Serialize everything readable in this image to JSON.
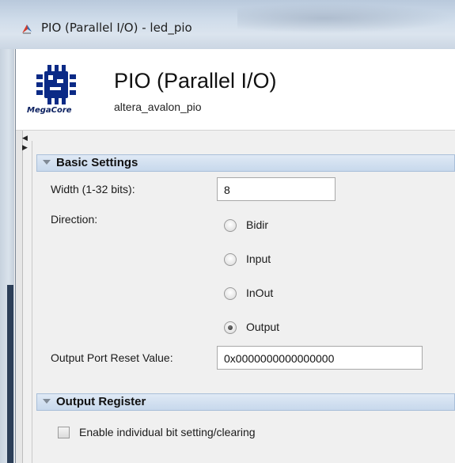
{
  "window": {
    "title": "PIO (Parallel I/O) - led_pio"
  },
  "header": {
    "logo_text": "MegaCore",
    "title": "PIO (Parallel I/O)",
    "subtitle": "altera_avalon_pio"
  },
  "basic_settings": {
    "section_label": "Basic Settings",
    "width_label": "Width (1-32 bits):",
    "width_value": "8",
    "direction_label": "Direction:",
    "direction_options": [
      {
        "label": "Bidir",
        "checked": false
      },
      {
        "label": "Input",
        "checked": false
      },
      {
        "label": "InOut",
        "checked": false
      },
      {
        "label": "Output",
        "checked": true
      }
    ],
    "reset_label": "Output Port Reset Value:",
    "reset_value": "0x0000000000000000"
  },
  "output_register": {
    "section_label": "Output Register",
    "bit_setting_label": "Enable individual bit setting/clearing",
    "bit_setting_checked": false
  },
  "colors": {
    "section_header": "#c7d8ec",
    "background": "#f0f0f0"
  },
  "icons": {
    "title_icon": "quartus-feather-icon",
    "section_toggle": "triangle-down-icon",
    "logo": "megacore-chip-logo"
  }
}
